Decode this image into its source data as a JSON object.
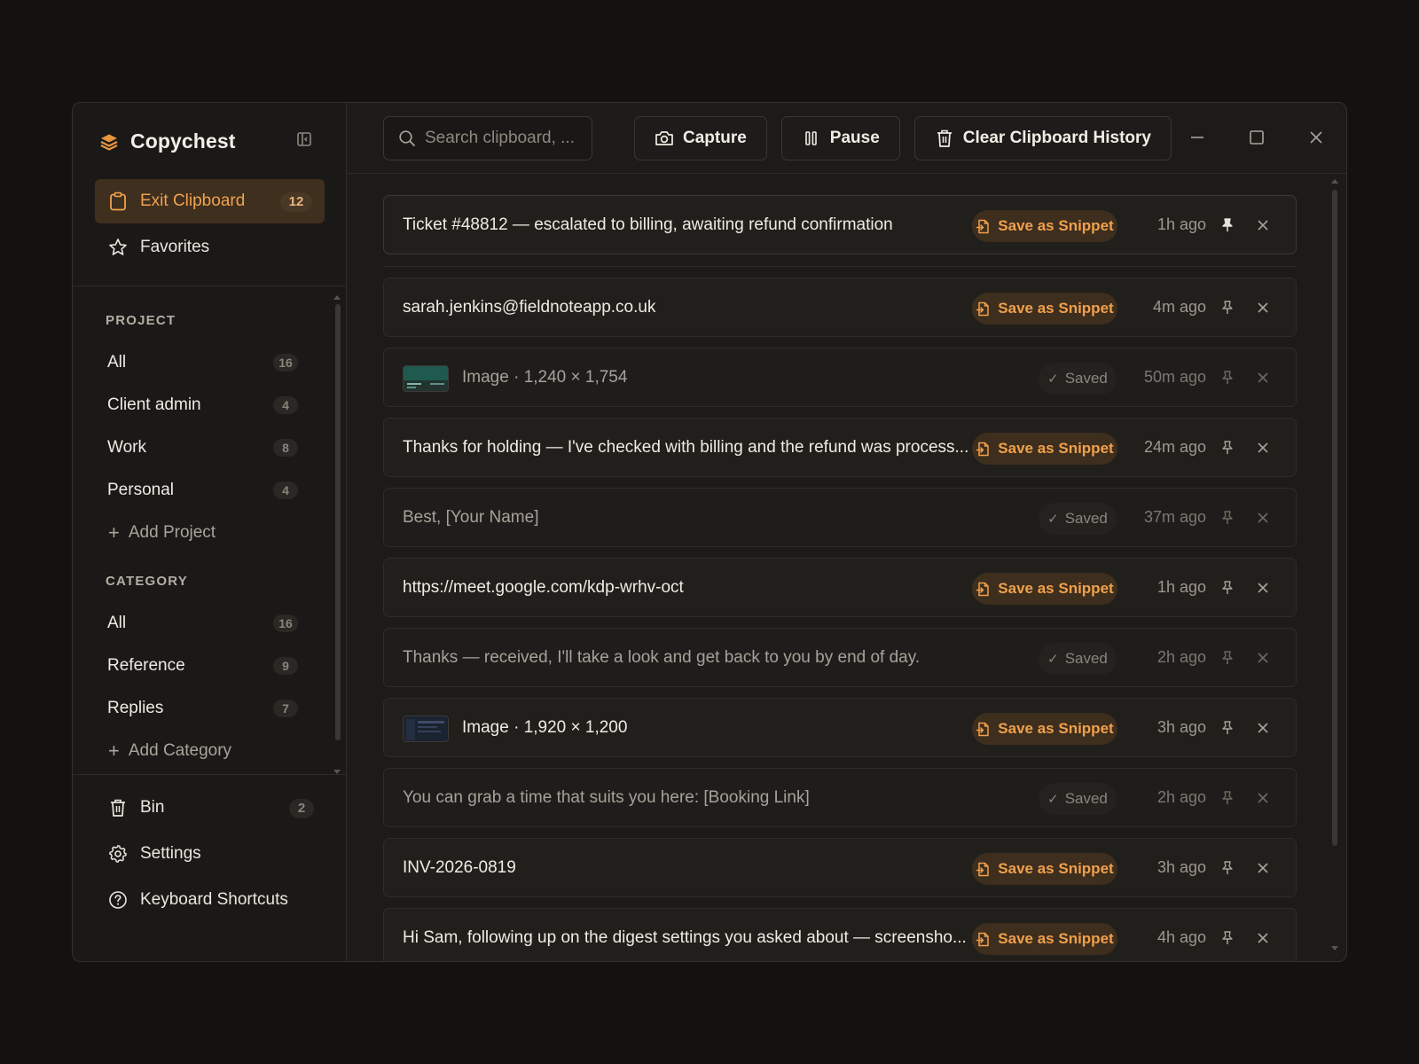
{
  "app": {
    "name": "Copychest",
    "accent": "#f0a34e"
  },
  "sidebar": {
    "top": [
      {
        "label": "Exit Clipboard",
        "count": "12",
        "icon": "clipboard-icon",
        "active": true
      },
      {
        "label": "Favorites",
        "icon": "star-icon"
      }
    ],
    "project": {
      "heading": "PROJECT",
      "items": [
        {
          "label": "All",
          "count": "16"
        },
        {
          "label": "Client admin",
          "count": "4"
        },
        {
          "label": "Work",
          "count": "8"
        },
        {
          "label": "Personal",
          "count": "4"
        }
      ],
      "add_label": "Add Project"
    },
    "category": {
      "heading": "CATEGORY",
      "items": [
        {
          "label": "All",
          "count": "16"
        },
        {
          "label": "Reference",
          "count": "9"
        },
        {
          "label": "Replies",
          "count": "7"
        }
      ],
      "add_label": "Add Category"
    },
    "bottom": [
      {
        "label": "Bin",
        "count": "2",
        "icon": "trash-icon"
      },
      {
        "label": "Settings",
        "icon": "gear-icon"
      },
      {
        "label": "Keyboard Shortcuts",
        "icon": "help-circle-icon"
      }
    ]
  },
  "toolbar": {
    "search_placeholder": "Search clipboard, ...",
    "capture_label": "Capture",
    "pause_label": "Pause",
    "clear_label": "Clear Clipboard History"
  },
  "clips": [
    {
      "text": "Ticket #48812 — escalated to billing, awaiting refund confirmation",
      "status": "snippet",
      "action": "Save as Snippet",
      "time": "1h ago",
      "pinned": true
    },
    {
      "text": "sarah.jenkins@fieldnoteapp.co.uk",
      "status": "snippet",
      "action": "Save as Snippet",
      "time": "4m ago"
    },
    {
      "text": "Image · 1,240 × 1,754",
      "status": "saved",
      "action": "Saved",
      "time": "50m ago",
      "thumb": "teal"
    },
    {
      "text": "Thanks for holding — I've checked with billing and the refund was process...",
      "status": "snippet",
      "action": "Save as Snippet",
      "time": "24m ago"
    },
    {
      "text": "Best, [Your Name]",
      "status": "saved",
      "action": "Saved",
      "time": "37m ago"
    },
    {
      "text": "https://meet.google.com/kdp-wrhv-oct",
      "status": "snippet",
      "action": "Save as Snippet",
      "time": "1h ago"
    },
    {
      "text": "Thanks — received, I'll take a look and get back to you by end of day.",
      "status": "saved",
      "action": "Saved",
      "time": "2h ago"
    },
    {
      "text": "Image · 1,920 × 1,200",
      "status": "snippet",
      "action": "Save as Snippet",
      "time": "3h ago",
      "thumb": "dark"
    },
    {
      "text": "You can grab a time that suits you here: [Booking Link]",
      "status": "saved",
      "action": "Saved",
      "time": "2h ago"
    },
    {
      "text": "INV-2026-0819",
      "status": "snippet",
      "action": "Save as Snippet",
      "time": "3h ago"
    },
    {
      "text": "Hi Sam, following up on the digest settings you asked about — screensho...",
      "status": "snippet",
      "action": "Save as Snippet",
      "time": "4h ago"
    }
  ]
}
